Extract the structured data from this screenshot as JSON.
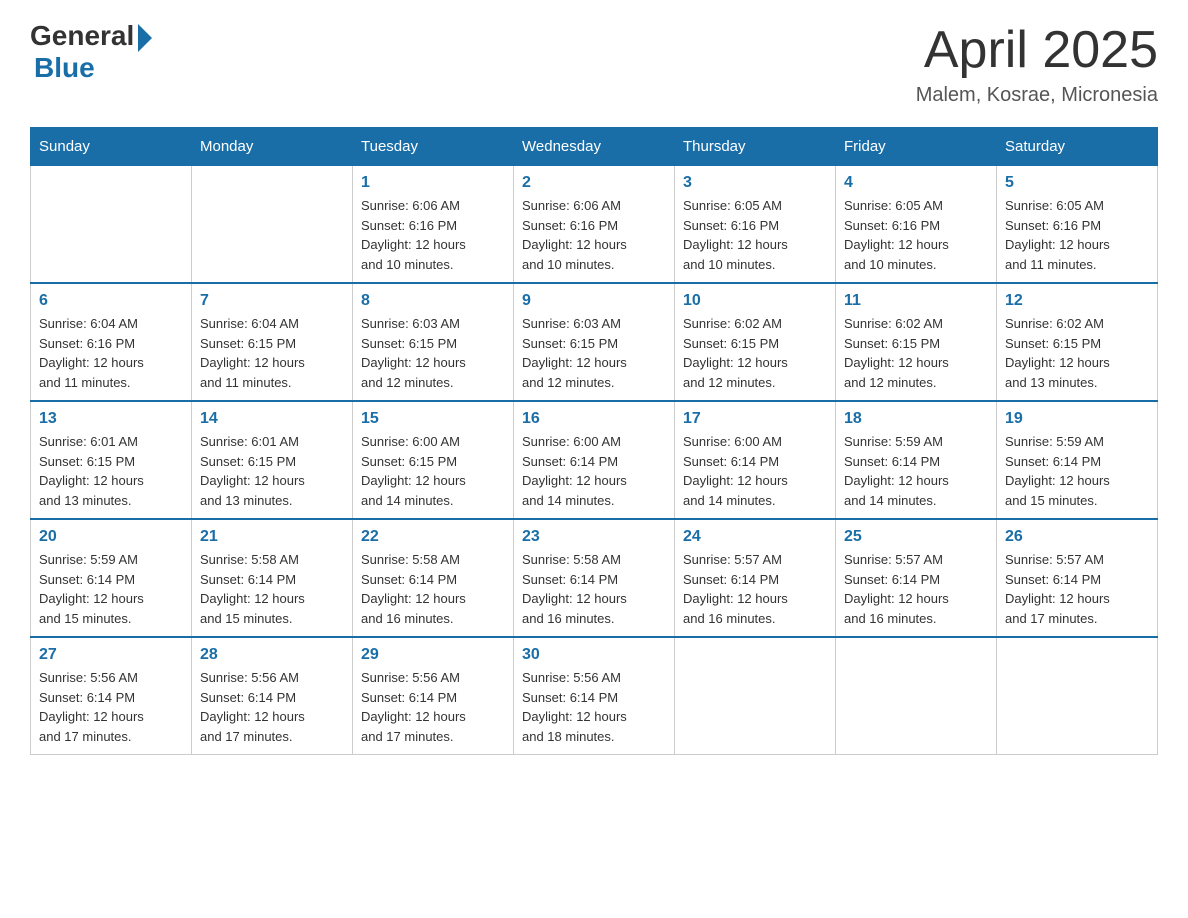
{
  "logo": {
    "general": "General",
    "blue": "Blue"
  },
  "title": "April 2025",
  "location": "Malem, Kosrae, Micronesia",
  "days_of_week": [
    "Sunday",
    "Monday",
    "Tuesday",
    "Wednesday",
    "Thursday",
    "Friday",
    "Saturday"
  ],
  "weeks": [
    [
      {
        "day": "",
        "info": ""
      },
      {
        "day": "",
        "info": ""
      },
      {
        "day": "1",
        "info": "Sunrise: 6:06 AM\nSunset: 6:16 PM\nDaylight: 12 hours\nand 10 minutes."
      },
      {
        "day": "2",
        "info": "Sunrise: 6:06 AM\nSunset: 6:16 PM\nDaylight: 12 hours\nand 10 minutes."
      },
      {
        "day": "3",
        "info": "Sunrise: 6:05 AM\nSunset: 6:16 PM\nDaylight: 12 hours\nand 10 minutes."
      },
      {
        "day": "4",
        "info": "Sunrise: 6:05 AM\nSunset: 6:16 PM\nDaylight: 12 hours\nand 10 minutes."
      },
      {
        "day": "5",
        "info": "Sunrise: 6:05 AM\nSunset: 6:16 PM\nDaylight: 12 hours\nand 11 minutes."
      }
    ],
    [
      {
        "day": "6",
        "info": "Sunrise: 6:04 AM\nSunset: 6:16 PM\nDaylight: 12 hours\nand 11 minutes."
      },
      {
        "day": "7",
        "info": "Sunrise: 6:04 AM\nSunset: 6:15 PM\nDaylight: 12 hours\nand 11 minutes."
      },
      {
        "day": "8",
        "info": "Sunrise: 6:03 AM\nSunset: 6:15 PM\nDaylight: 12 hours\nand 12 minutes."
      },
      {
        "day": "9",
        "info": "Sunrise: 6:03 AM\nSunset: 6:15 PM\nDaylight: 12 hours\nand 12 minutes."
      },
      {
        "day": "10",
        "info": "Sunrise: 6:02 AM\nSunset: 6:15 PM\nDaylight: 12 hours\nand 12 minutes."
      },
      {
        "day": "11",
        "info": "Sunrise: 6:02 AM\nSunset: 6:15 PM\nDaylight: 12 hours\nand 12 minutes."
      },
      {
        "day": "12",
        "info": "Sunrise: 6:02 AM\nSunset: 6:15 PM\nDaylight: 12 hours\nand 13 minutes."
      }
    ],
    [
      {
        "day": "13",
        "info": "Sunrise: 6:01 AM\nSunset: 6:15 PM\nDaylight: 12 hours\nand 13 minutes."
      },
      {
        "day": "14",
        "info": "Sunrise: 6:01 AM\nSunset: 6:15 PM\nDaylight: 12 hours\nand 13 minutes."
      },
      {
        "day": "15",
        "info": "Sunrise: 6:00 AM\nSunset: 6:15 PM\nDaylight: 12 hours\nand 14 minutes."
      },
      {
        "day": "16",
        "info": "Sunrise: 6:00 AM\nSunset: 6:14 PM\nDaylight: 12 hours\nand 14 minutes."
      },
      {
        "day": "17",
        "info": "Sunrise: 6:00 AM\nSunset: 6:14 PM\nDaylight: 12 hours\nand 14 minutes."
      },
      {
        "day": "18",
        "info": "Sunrise: 5:59 AM\nSunset: 6:14 PM\nDaylight: 12 hours\nand 14 minutes."
      },
      {
        "day": "19",
        "info": "Sunrise: 5:59 AM\nSunset: 6:14 PM\nDaylight: 12 hours\nand 15 minutes."
      }
    ],
    [
      {
        "day": "20",
        "info": "Sunrise: 5:59 AM\nSunset: 6:14 PM\nDaylight: 12 hours\nand 15 minutes."
      },
      {
        "day": "21",
        "info": "Sunrise: 5:58 AM\nSunset: 6:14 PM\nDaylight: 12 hours\nand 15 minutes."
      },
      {
        "day": "22",
        "info": "Sunrise: 5:58 AM\nSunset: 6:14 PM\nDaylight: 12 hours\nand 16 minutes."
      },
      {
        "day": "23",
        "info": "Sunrise: 5:58 AM\nSunset: 6:14 PM\nDaylight: 12 hours\nand 16 minutes."
      },
      {
        "day": "24",
        "info": "Sunrise: 5:57 AM\nSunset: 6:14 PM\nDaylight: 12 hours\nand 16 minutes."
      },
      {
        "day": "25",
        "info": "Sunrise: 5:57 AM\nSunset: 6:14 PM\nDaylight: 12 hours\nand 16 minutes."
      },
      {
        "day": "26",
        "info": "Sunrise: 5:57 AM\nSunset: 6:14 PM\nDaylight: 12 hours\nand 17 minutes."
      }
    ],
    [
      {
        "day": "27",
        "info": "Sunrise: 5:56 AM\nSunset: 6:14 PM\nDaylight: 12 hours\nand 17 minutes."
      },
      {
        "day": "28",
        "info": "Sunrise: 5:56 AM\nSunset: 6:14 PM\nDaylight: 12 hours\nand 17 minutes."
      },
      {
        "day": "29",
        "info": "Sunrise: 5:56 AM\nSunset: 6:14 PM\nDaylight: 12 hours\nand 17 minutes."
      },
      {
        "day": "30",
        "info": "Sunrise: 5:56 AM\nSunset: 6:14 PM\nDaylight: 12 hours\nand 18 minutes."
      },
      {
        "day": "",
        "info": ""
      },
      {
        "day": "",
        "info": ""
      },
      {
        "day": "",
        "info": ""
      }
    ]
  ]
}
